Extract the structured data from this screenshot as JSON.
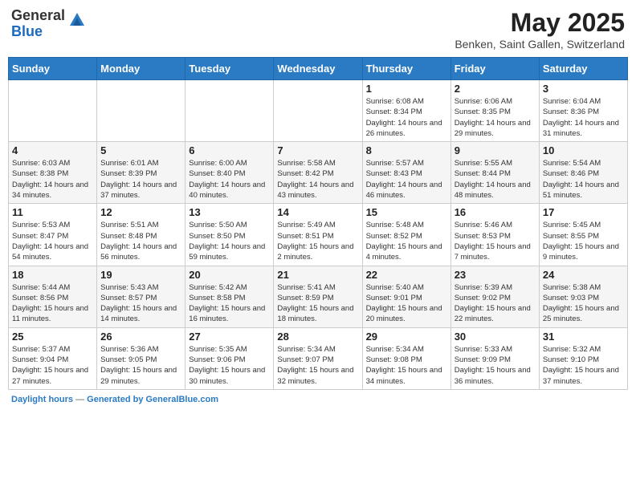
{
  "header": {
    "logo": {
      "line1": "General",
      "line2": "Blue"
    },
    "month": "May 2025",
    "location": "Benken, Saint Gallen, Switzerland"
  },
  "weekdays": [
    "Sunday",
    "Monday",
    "Tuesday",
    "Wednesday",
    "Thursday",
    "Friday",
    "Saturday"
  ],
  "weeks": [
    [
      {
        "day": "",
        "info": ""
      },
      {
        "day": "",
        "info": ""
      },
      {
        "day": "",
        "info": ""
      },
      {
        "day": "",
        "info": ""
      },
      {
        "day": "1",
        "info": "Sunrise: 6:08 AM\nSunset: 8:34 PM\nDaylight: 14 hours and 26 minutes."
      },
      {
        "day": "2",
        "info": "Sunrise: 6:06 AM\nSunset: 8:35 PM\nDaylight: 14 hours and 29 minutes."
      },
      {
        "day": "3",
        "info": "Sunrise: 6:04 AM\nSunset: 8:36 PM\nDaylight: 14 hours and 31 minutes."
      }
    ],
    [
      {
        "day": "4",
        "info": "Sunrise: 6:03 AM\nSunset: 8:38 PM\nDaylight: 14 hours and 34 minutes."
      },
      {
        "day": "5",
        "info": "Sunrise: 6:01 AM\nSunset: 8:39 PM\nDaylight: 14 hours and 37 minutes."
      },
      {
        "day": "6",
        "info": "Sunrise: 6:00 AM\nSunset: 8:40 PM\nDaylight: 14 hours and 40 minutes."
      },
      {
        "day": "7",
        "info": "Sunrise: 5:58 AM\nSunset: 8:42 PM\nDaylight: 14 hours and 43 minutes."
      },
      {
        "day": "8",
        "info": "Sunrise: 5:57 AM\nSunset: 8:43 PM\nDaylight: 14 hours and 46 minutes."
      },
      {
        "day": "9",
        "info": "Sunrise: 5:55 AM\nSunset: 8:44 PM\nDaylight: 14 hours and 48 minutes."
      },
      {
        "day": "10",
        "info": "Sunrise: 5:54 AM\nSunset: 8:46 PM\nDaylight: 14 hours and 51 minutes."
      }
    ],
    [
      {
        "day": "11",
        "info": "Sunrise: 5:53 AM\nSunset: 8:47 PM\nDaylight: 14 hours and 54 minutes."
      },
      {
        "day": "12",
        "info": "Sunrise: 5:51 AM\nSunset: 8:48 PM\nDaylight: 14 hours and 56 minutes."
      },
      {
        "day": "13",
        "info": "Sunrise: 5:50 AM\nSunset: 8:50 PM\nDaylight: 14 hours and 59 minutes."
      },
      {
        "day": "14",
        "info": "Sunrise: 5:49 AM\nSunset: 8:51 PM\nDaylight: 15 hours and 2 minutes."
      },
      {
        "day": "15",
        "info": "Sunrise: 5:48 AM\nSunset: 8:52 PM\nDaylight: 15 hours and 4 minutes."
      },
      {
        "day": "16",
        "info": "Sunrise: 5:46 AM\nSunset: 8:53 PM\nDaylight: 15 hours and 7 minutes."
      },
      {
        "day": "17",
        "info": "Sunrise: 5:45 AM\nSunset: 8:55 PM\nDaylight: 15 hours and 9 minutes."
      }
    ],
    [
      {
        "day": "18",
        "info": "Sunrise: 5:44 AM\nSunset: 8:56 PM\nDaylight: 15 hours and 11 minutes."
      },
      {
        "day": "19",
        "info": "Sunrise: 5:43 AM\nSunset: 8:57 PM\nDaylight: 15 hours and 14 minutes."
      },
      {
        "day": "20",
        "info": "Sunrise: 5:42 AM\nSunset: 8:58 PM\nDaylight: 15 hours and 16 minutes."
      },
      {
        "day": "21",
        "info": "Sunrise: 5:41 AM\nSunset: 8:59 PM\nDaylight: 15 hours and 18 minutes."
      },
      {
        "day": "22",
        "info": "Sunrise: 5:40 AM\nSunset: 9:01 PM\nDaylight: 15 hours and 20 minutes."
      },
      {
        "day": "23",
        "info": "Sunrise: 5:39 AM\nSunset: 9:02 PM\nDaylight: 15 hours and 22 minutes."
      },
      {
        "day": "24",
        "info": "Sunrise: 5:38 AM\nSunset: 9:03 PM\nDaylight: 15 hours and 25 minutes."
      }
    ],
    [
      {
        "day": "25",
        "info": "Sunrise: 5:37 AM\nSunset: 9:04 PM\nDaylight: 15 hours and 27 minutes."
      },
      {
        "day": "26",
        "info": "Sunrise: 5:36 AM\nSunset: 9:05 PM\nDaylight: 15 hours and 29 minutes."
      },
      {
        "day": "27",
        "info": "Sunrise: 5:35 AM\nSunset: 9:06 PM\nDaylight: 15 hours and 30 minutes."
      },
      {
        "day": "28",
        "info": "Sunrise: 5:34 AM\nSunset: 9:07 PM\nDaylight: 15 hours and 32 minutes."
      },
      {
        "day": "29",
        "info": "Sunrise: 5:34 AM\nSunset: 9:08 PM\nDaylight: 15 hours and 34 minutes."
      },
      {
        "day": "30",
        "info": "Sunrise: 5:33 AM\nSunset: 9:09 PM\nDaylight: 15 hours and 36 minutes."
      },
      {
        "day": "31",
        "info": "Sunrise: 5:32 AM\nSunset: 9:10 PM\nDaylight: 15 hours and 37 minutes."
      }
    ]
  ],
  "footer": {
    "label": "Daylight hours",
    "generated": "Generated by GeneralBlue.com"
  }
}
